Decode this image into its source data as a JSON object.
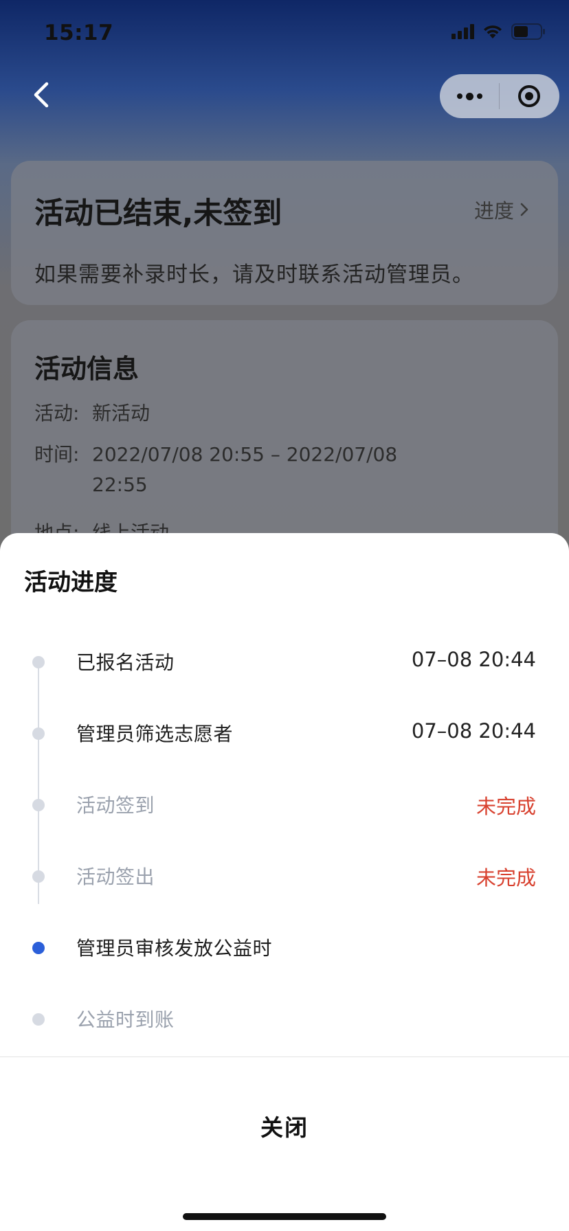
{
  "status_bar": {
    "time": "15:17"
  },
  "status_card": {
    "title": "活动已结束,未签到",
    "progress_label": "进度",
    "description": "如果需要补录时长，请及时联系活动管理员。"
  },
  "info_card": {
    "title": "活动信息",
    "rows": [
      {
        "key": "活动:",
        "value": "新活动"
      },
      {
        "key": "时间:",
        "value": "2022/07/08 20:55 – 2022/07/08 22:55"
      },
      {
        "key": "地点:",
        "value": "线上活动"
      }
    ]
  },
  "sheet": {
    "title": "活动进度",
    "steps": [
      {
        "label": "已报名活动",
        "time": "07–08 20:44",
        "status": ""
      },
      {
        "label": "管理员筛选志愿者",
        "time": "07–08 20:44",
        "status": ""
      },
      {
        "label": "活动签到",
        "time": "",
        "status": "未完成"
      },
      {
        "label": "活动签出",
        "time": "",
        "status": "未完成"
      },
      {
        "label": "管理员审核发放公益时",
        "time": "",
        "status": ""
      },
      {
        "label": "公益时到账",
        "time": "",
        "status": ""
      }
    ],
    "close_label": "关闭"
  },
  "colors": {
    "active_dot": "#2b5fd9",
    "inactive_dot": "#d6dae2",
    "incomplete_text": "#d8412f",
    "muted_text": "#9aa1ad"
  }
}
